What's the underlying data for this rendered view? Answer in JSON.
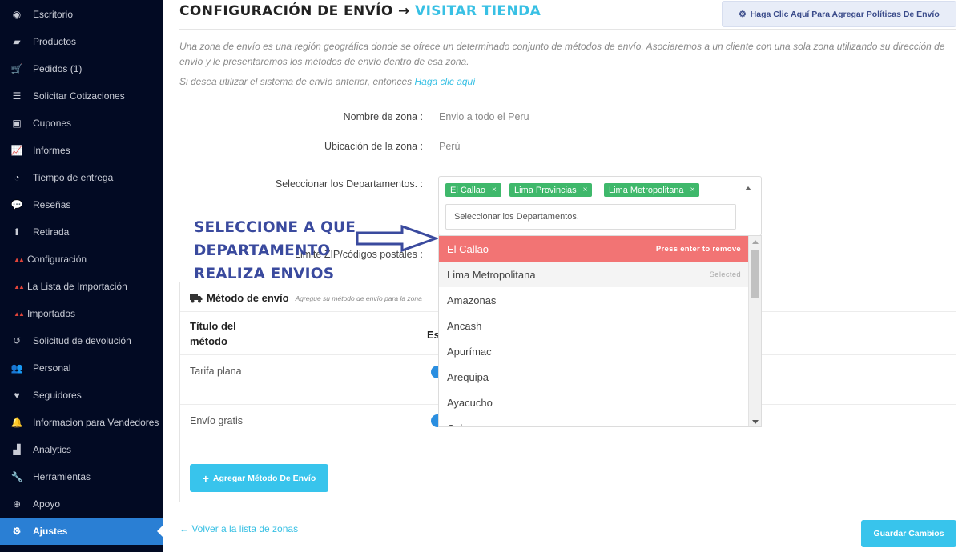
{
  "sidebar": {
    "items": [
      {
        "label": "Escritorio",
        "icon": "palette-icon",
        "glyph": "◉"
      },
      {
        "label": "Productos",
        "icon": "briefcase-icon",
        "glyph": "▰"
      },
      {
        "label": "Pedidos (1)",
        "icon": "cart-icon",
        "glyph": "🛒"
      },
      {
        "label": "Solicitar Cotizaciones",
        "icon": "list-icon",
        "glyph": "☰"
      },
      {
        "label": "Cupones",
        "icon": "gift-icon",
        "glyph": "▣"
      },
      {
        "label": "Informes",
        "icon": "chart-icon",
        "glyph": "📈"
      },
      {
        "label": "Tiempo de entrega",
        "icon": "clock-icon",
        "glyph": "◔"
      },
      {
        "label": "Reseñas",
        "icon": "comments-icon",
        "glyph": "💬"
      },
      {
        "label": "Retirada",
        "icon": "upload-icon",
        "glyph": "⬆"
      },
      {
        "label": "Configuración",
        "icon": "brand-logo-icon",
        "glyph": "▲▲"
      },
      {
        "label": "La Lista de Importación",
        "icon": "brand-logo-icon",
        "glyph": "▲▲"
      },
      {
        "label": "Importados",
        "icon": "brand-logo-icon",
        "glyph": "▲▲"
      },
      {
        "label": "Solicitud de devolución",
        "icon": "undo-icon",
        "glyph": "↺"
      },
      {
        "label": "Personal",
        "icon": "users-icon",
        "glyph": "👥"
      },
      {
        "label": "Seguidores",
        "icon": "heart-icon",
        "glyph": "♥"
      },
      {
        "label": "Informacion para Vendedores",
        "icon": "bell-icon",
        "glyph": "🔔"
      },
      {
        "label": "Analytics",
        "icon": "area-chart-icon",
        "glyph": "▟"
      },
      {
        "label": "Herramientas",
        "icon": "wrench-icon",
        "glyph": "🔧"
      },
      {
        "label": "Apoyo",
        "icon": "globe-icon",
        "glyph": "⊕"
      },
      {
        "label": "Ajustes",
        "icon": "gear-icon",
        "glyph": "⚙"
      }
    ]
  },
  "header": {
    "title": "CONFIGURACIÓN DE ENVÍO →",
    "title_link": "VISITAR TIENDA",
    "policy_button": "Haga Clic Aquí Para Agregar Políticas De Envío"
  },
  "intro": {
    "text": "Una zona de envío es una región geográfica donde se ofrece un determinado conjunto de métodos de envío. Asociaremos a un cliente con una sola zona utilizando su dirección de envío y le presentaremos los métodos de envío dentro de esa zona.",
    "legacy_text": "Si desea utilizar el sistema de envío anterior, entonces",
    "legacy_link": "Haga clic aquí"
  },
  "form": {
    "zone_name_label": "Nombre de zona :",
    "zone_name_value": "Envio a todo el Peru",
    "zone_location_label": "Ubicación de la zona :",
    "zone_location_value": "Perú",
    "departments_label": "Seleccionar los Departamentos. :",
    "zip_label": "Limite ZIP/códigos postales :",
    "selected_tags": [
      "El Callao",
      "Lima Provincias",
      "Lima Metropolitana"
    ],
    "search_value": "Seleccionar los Departamentos."
  },
  "dropdown": {
    "options": [
      {
        "label": "El Callao",
        "hint": "Press enter to remove",
        "state": "highlight"
      },
      {
        "label": "Lima Metropolitana",
        "hint": "Selected",
        "state": "selected"
      },
      {
        "label": "Amazonas",
        "hint": "",
        "state": ""
      },
      {
        "label": "Ancash",
        "hint": "",
        "state": ""
      },
      {
        "label": "Apurímac",
        "hint": "",
        "state": ""
      },
      {
        "label": "Arequipa",
        "hint": "",
        "state": ""
      },
      {
        "label": "Ayacucho",
        "hint": "",
        "state": ""
      },
      {
        "label": "Cajamarca",
        "hint": "",
        "state": ""
      }
    ]
  },
  "annotation": {
    "line1": "SELECCIONE A QUE",
    "line2": "DEPARTAMENTO",
    "line3": "REALIZA ENVIOS"
  },
  "shipping": {
    "title": "Método de envío",
    "subtitle": "Agregue su método de envío para la zona",
    "col_title_1": "Título del",
    "col_title_2": "método",
    "col_status": "Es",
    "rows": [
      "Tarifa plana",
      "Envío gratis"
    ],
    "add_button": "Agregar Método De Envío"
  },
  "footer": {
    "back_link": "← Volver a la lista de zonas",
    "save_button": "Guardar Cambios"
  },
  "colors": {
    "sidebar_bg": "#020a23",
    "active_item": "#2a7fd4",
    "accent": "#38c4ec",
    "tag_green": "#3fb86b",
    "highlight_red": "#f27474",
    "annotation_blue": "#3a4a9e"
  }
}
